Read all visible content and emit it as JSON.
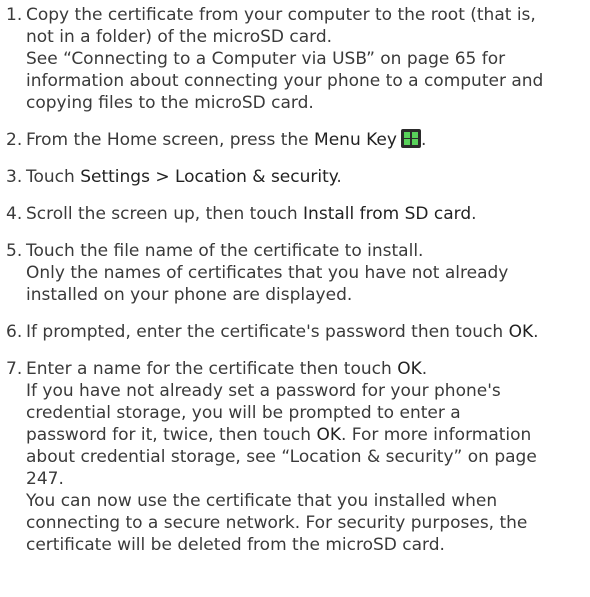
{
  "steps": [
    {
      "num": "1.",
      "lines": [
        "Copy the certificate from your computer to the root (that is,",
        "not in a folder) of the microSD card.",
        "See “Connecting to a Computer via USB” on page 65 for",
        "information about connecting your phone to a computer and",
        "copying files to the microSD card."
      ]
    },
    {
      "num": "2.",
      "text_before": "From the Home screen, press the ",
      "strong": "Menu Key",
      "icon": "menu-key-icon",
      "text_after": "."
    },
    {
      "num": "3.",
      "text_before": "Touch ",
      "strong": "Settings > Location & security",
      "text_after": "."
    },
    {
      "num": "4.",
      "text_before": "Scroll the screen up, then touch ",
      "strong": "Install from SD card",
      "text_after": "."
    },
    {
      "num": "5.",
      "lines": [
        "Touch the file name of the certificate to install.",
        "Only the names of certificates that you have not already",
        "installed on your phone are displayed."
      ]
    },
    {
      "num": "6.",
      "text_before": "If prompted, enter the certificate's password then touch ",
      "strong": "OK",
      "text_after": "."
    },
    {
      "num": "7.",
      "line1_before": "Enter a name for the certificate then touch ",
      "line1_strong": "OK",
      "line1_after": ".",
      "line2": "If you have not already set a password for your phone's",
      "line3": "credential storage, you will be prompted to enter a",
      "line4_before": "password for it, twice, then touch ",
      "line4_strong": "OK",
      "line4_after": ". For more information",
      "line5": "about credential storage, see “Location & security” on page",
      "line6": "247.",
      "line7": "You can now use the certificate that you installed when",
      "line8": "connecting to a secure network. For security purposes, the",
      "line9": "certificate will be deleted from the microSD card."
    }
  ]
}
